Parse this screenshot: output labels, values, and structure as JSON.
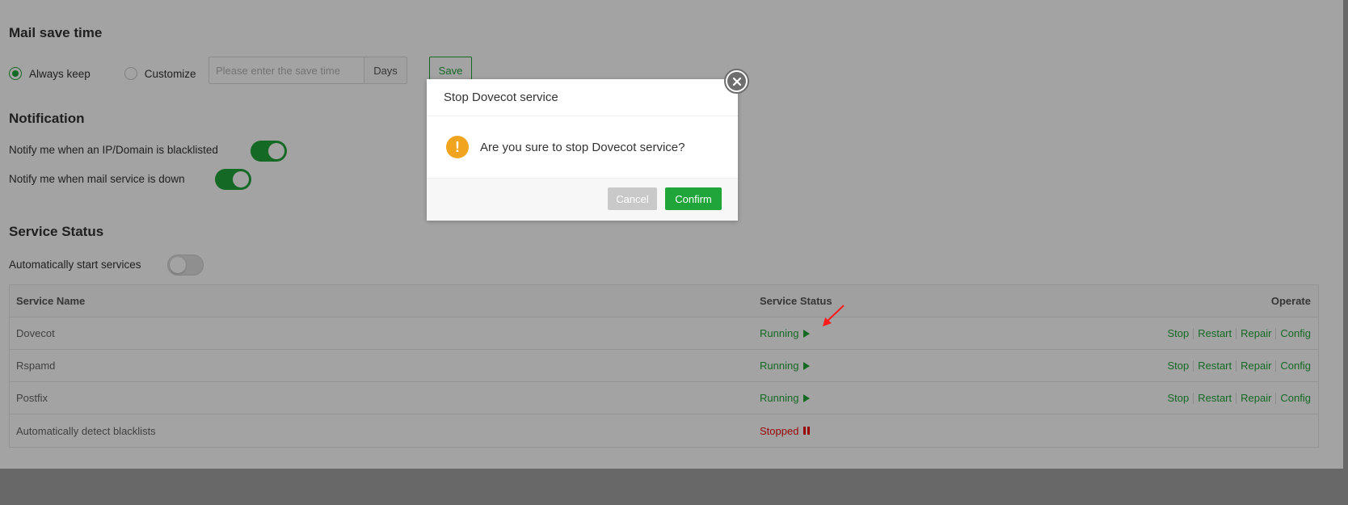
{
  "mail_save_time": {
    "title": "Mail save time",
    "options": [
      "Always keep",
      "Customize"
    ],
    "selected": "Always keep",
    "input_placeholder": "Please enter the save time",
    "unit": "Days",
    "save_label": "Save"
  },
  "notification": {
    "title": "Notification",
    "items": [
      {
        "label": "Notify me when an IP/Domain is blacklisted",
        "enabled": true
      },
      {
        "label": "Notify me when mail service is down",
        "enabled": true
      }
    ]
  },
  "service_status": {
    "title": "Service Status",
    "auto_start_label": "Automatically start services",
    "auto_start_enabled": false,
    "columns": [
      "Service Name",
      "Service Status",
      "Operate"
    ],
    "rows": [
      {
        "name": "Dovecot",
        "status": "Running",
        "ops": [
          "Stop",
          "Restart",
          "Repair",
          "Config"
        ]
      },
      {
        "name": "Rspamd",
        "status": "Running",
        "ops": [
          "Stop",
          "Restart",
          "Repair",
          "Config"
        ]
      },
      {
        "name": "Postfix",
        "status": "Running",
        "ops": [
          "Stop",
          "Restart",
          "Repair",
          "Config"
        ]
      },
      {
        "name": "Automatically detect blacklists",
        "status": "Stopped",
        "ops": []
      }
    ]
  },
  "dialog": {
    "title": "Stop Dovecot service",
    "message": "Are you sure to stop Dovecot service?",
    "cancel_label": "Cancel",
    "confirm_label": "Confirm",
    "warn_glyph": "!",
    "icon": "warning-icon"
  },
  "colors": {
    "accent": "#20a53a",
    "danger": "#ef0808",
    "warning": "#f0a41f"
  }
}
